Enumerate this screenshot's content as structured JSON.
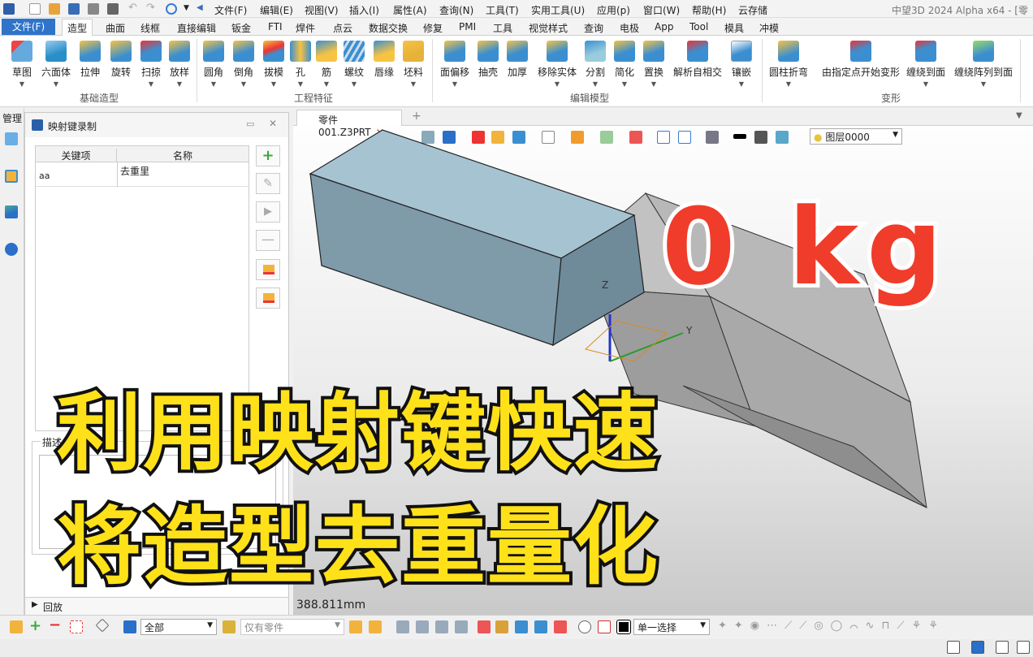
{
  "app_title": "中望3D 2024 Alpha x64 - [零",
  "menu": [
    "文件(F)",
    "编辑(E)",
    "视图(V)",
    "插入(I)",
    "属性(A)",
    "查询(N)",
    "工具(T)",
    "实用工具(U)",
    "应用(p)",
    "窗口(W)",
    "帮助(H)",
    "云存储"
  ],
  "file_tab": "文件(F)",
  "tabs": [
    "造型",
    "曲面",
    "线框",
    "直接编辑",
    "钣金",
    "FTI",
    "焊件",
    "点云",
    "数据交换",
    "修复",
    "PMI",
    "工具",
    "视觉样式",
    "查询",
    "电极",
    "App",
    "Tool",
    "模具",
    "冲模"
  ],
  "ribbon": {
    "groups": [
      "基础造型",
      "工程特征",
      "编辑模型",
      "变形"
    ],
    "basic": [
      "草图",
      "六面体",
      "拉伸",
      "旋转",
      "扫掠",
      "放样"
    ],
    "engineering": [
      "圆角",
      "倒角",
      "拔模",
      "孔",
      "筋",
      "螺纹",
      "唇缘",
      "坯料"
    ],
    "edit": [
      "面偏移",
      "抽壳",
      "加厚",
      "移除实体",
      "分割",
      "简化",
      "置换",
      "解析自相交",
      "镶嵌"
    ],
    "deform": [
      "圆柱折弯",
      "由指定点开始变形",
      "缠绕到面",
      "缠绕阵列到面"
    ]
  },
  "left_strip_label": "管理",
  "panel": {
    "title": "映射键录制",
    "col_key": "关键项",
    "col_name": "名称",
    "row_key": "aa",
    "row_name": "去重里",
    "desc_label": "描述",
    "replay_label": "回放"
  },
  "doc_tab": "零件001.Z3PRT",
  "layer_combo": "图层0000",
  "measure": "388.811mm",
  "weight_overlay": "0 kg",
  "headline": [
    "利用映射键快速",
    "将造型去重量化"
  ],
  "status": {
    "filter_all": "全部",
    "filter_part": "仅有零件",
    "select_mode": "单一选择"
  },
  "axis": {
    "z": "Z",
    "y": "Y"
  },
  "colors": {
    "accent": "#2f74c9",
    "headline": "#ffe11a",
    "weight": "#f03c2a",
    "box_top": "#a6c3d2",
    "box_front": "#7f9aa9",
    "ghost": "#a9a9a9"
  }
}
